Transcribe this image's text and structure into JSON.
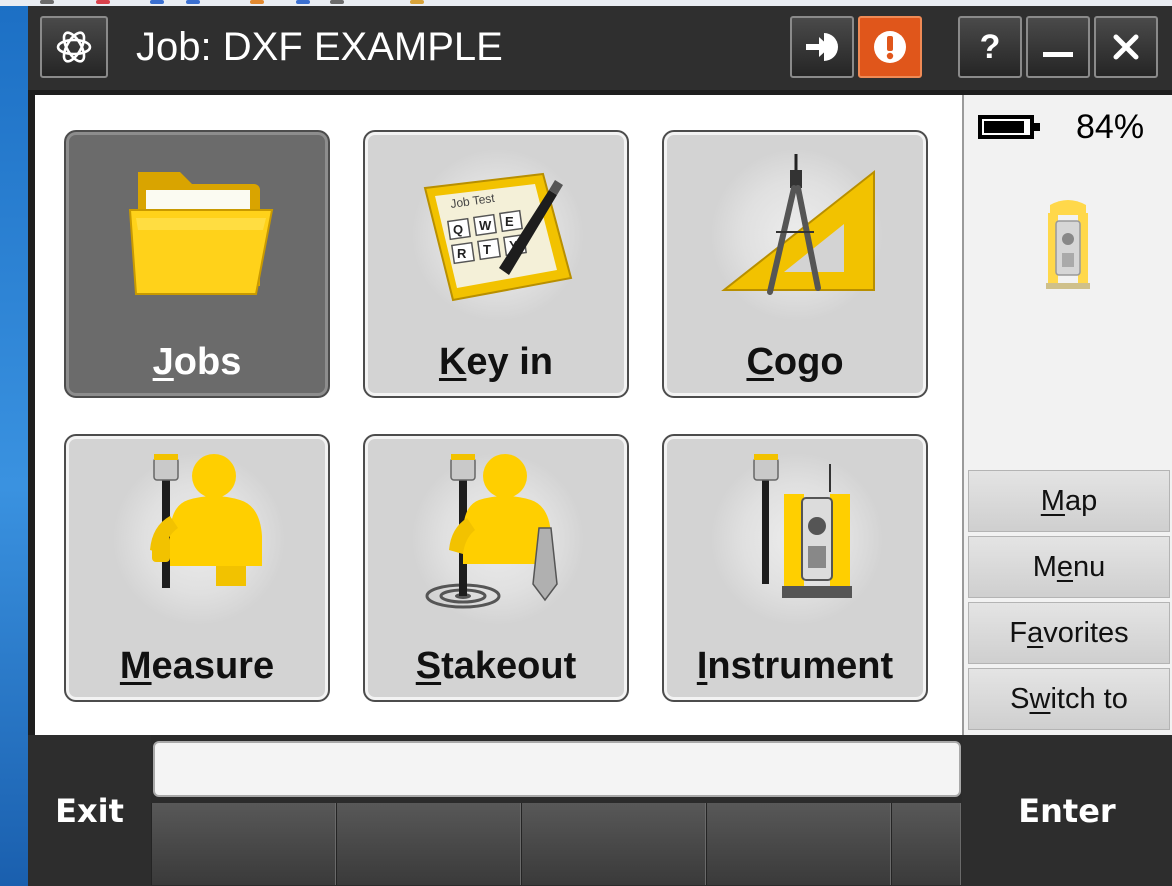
{
  "window": {
    "title": "Job: DXF EXAMPLE",
    "buttons": {
      "help": "?",
      "minimize": "—",
      "close": "✕"
    },
    "icons": [
      "trimble-logo-icon",
      "connect-icon",
      "warning-icon"
    ]
  },
  "tiles": [
    {
      "label": "Jobs",
      "underline": "J",
      "rest": "obs",
      "icon": "folder-icon",
      "selected": true
    },
    {
      "label": "Key in",
      "underline": "K",
      "rest": "ey in",
      "icon": "keyboard-icon",
      "selected": false
    },
    {
      "label": "Cogo",
      "underline": "C",
      "rest": "ogo",
      "icon": "compass-icon",
      "selected": false
    },
    {
      "label": "Measure",
      "underline": "M",
      "rest": "easure",
      "icon": "surveyor-measure-icon",
      "selected": false
    },
    {
      "label": "Stakeout",
      "underline": "S",
      "rest": "takeout",
      "icon": "surveyor-stakeout-icon",
      "selected": false
    },
    {
      "label": "Instrument",
      "underline": "I",
      "rest": "nstrument",
      "icon": "total-station-icon",
      "selected": false
    }
  ],
  "status": {
    "battery_percent": "84%",
    "battery_level": 0.84,
    "instrument_icon": "total-station-status-icon"
  },
  "side_buttons": [
    {
      "label": "Map",
      "pre": "",
      "underline": "M",
      "post": "ap"
    },
    {
      "label": "Menu",
      "pre": "M",
      "underline": "e",
      "post": "nu"
    },
    {
      "label": "Favorites",
      "pre": "F",
      "underline": "a",
      "post": "vorites"
    },
    {
      "label": "Switch to",
      "pre": "S",
      "underline": "w",
      "post": "itch to"
    }
  ],
  "bottom": {
    "exit_label": "Exit",
    "enter_label": "Enter",
    "status_text": ""
  },
  "colors": {
    "warning": "#e0561b",
    "accent_yellow": "#f2c200",
    "selected_tile": "#6b6b6b"
  }
}
